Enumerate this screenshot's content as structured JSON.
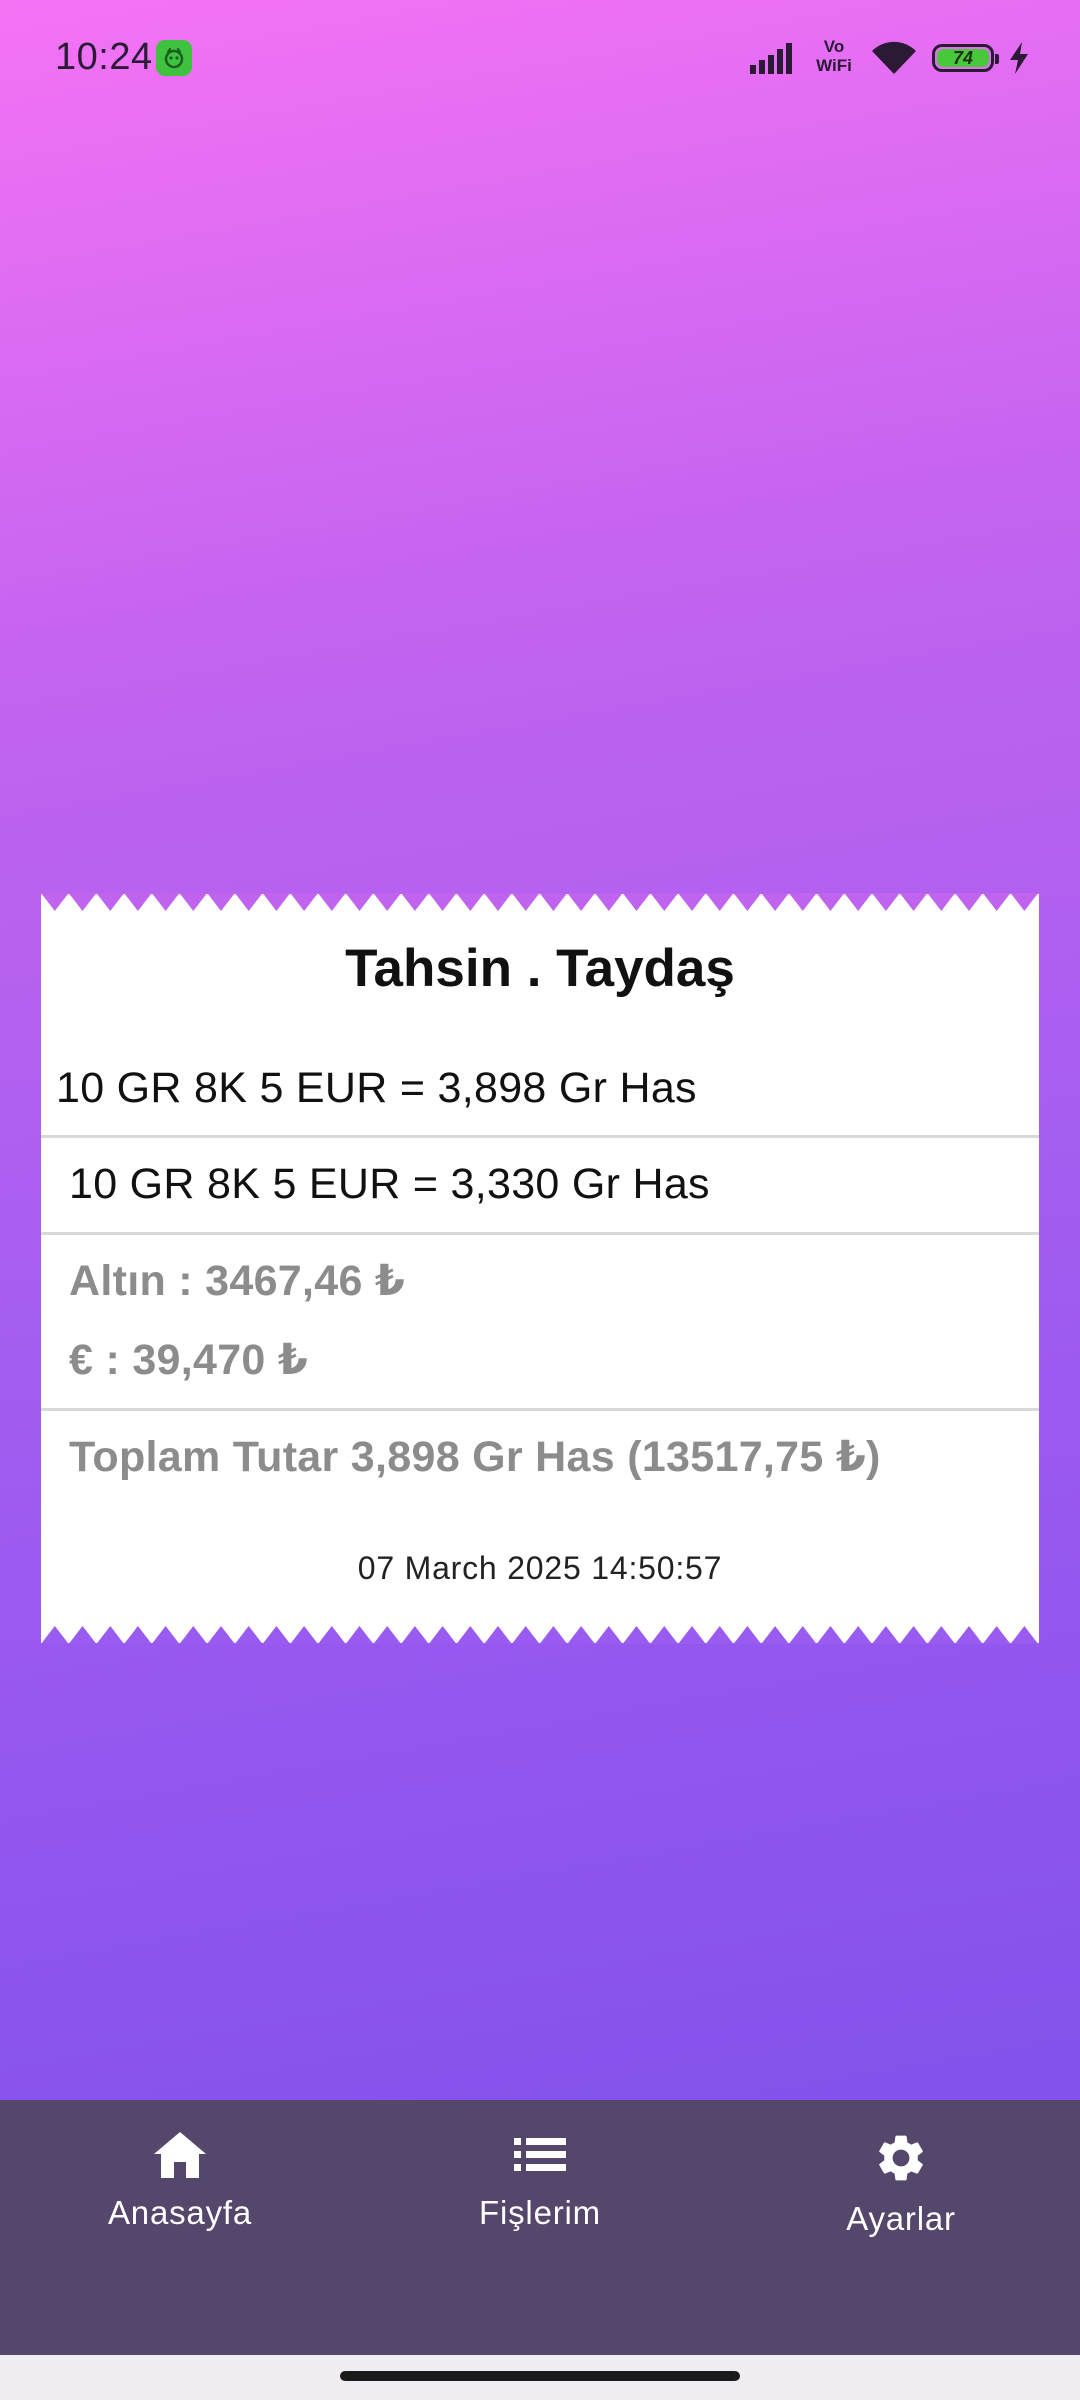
{
  "status_bar": {
    "time": "10:24",
    "battery_level": "74",
    "network_label_top": "Vo",
    "network_label_bottom": "WiFi",
    "icons": [
      "app-notification-icon",
      "signal-icon",
      "vowifi-icon",
      "wifi-icon",
      "battery-icon",
      "charging-bolt-icon"
    ]
  },
  "receipt": {
    "title": "Tahsin . Taydaş",
    "line1": "10 GR 8K 5 EUR = 3,898 Gr Has",
    "line2": "10 GR 8K 5 EUR = 3,330 Gr Has",
    "gold_price": "Altın : 3467,46 ₺",
    "euro_price": "€ : 39,470 ₺",
    "total": "Toplam Tutar 3,898 Gr Has (13517,75 ₺)",
    "date": "07 March 2025 14:50:57"
  },
  "bottom_nav": {
    "items": [
      {
        "label": "Anasayfa",
        "icon": "home-icon"
      },
      {
        "label": "Fişlerim",
        "icon": "list-icon"
      },
      {
        "label": "Ayarlar",
        "icon": "gear-icon"
      }
    ]
  },
  "colors": {
    "gradient_top": "#f573f5",
    "gradient_bottom": "#7a4de8",
    "nav_background": "#55466b",
    "receipt_background": "#ffffff",
    "muted_text": "#8c8c8c"
  }
}
